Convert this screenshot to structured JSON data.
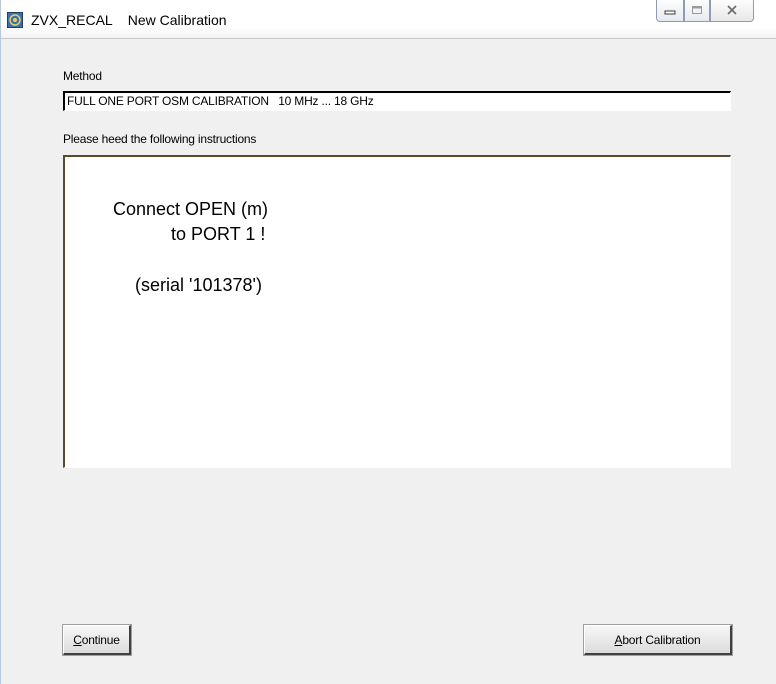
{
  "window": {
    "app_name": "ZVX_RECAL",
    "dialog_title": "New Calibration"
  },
  "method": {
    "label": "Method",
    "value": "FULL ONE PORT OSM CALIBRATION   10 MHz ... 18 GHz"
  },
  "instructions": {
    "label": "Please heed the following instructions",
    "line1": "Connect OPEN (m)",
    "line2": "to PORT 1 !",
    "line3": "(serial '101378')"
  },
  "buttons": {
    "continue_mnemonic": "C",
    "continue_rest": "ontinue",
    "abort_mnemonic": "A",
    "abort_rest": "bort Calibration"
  },
  "icons": {
    "app": "app-icon",
    "minimize": "minimize-icon",
    "maximize": "maximize-icon",
    "close": "close-icon"
  }
}
